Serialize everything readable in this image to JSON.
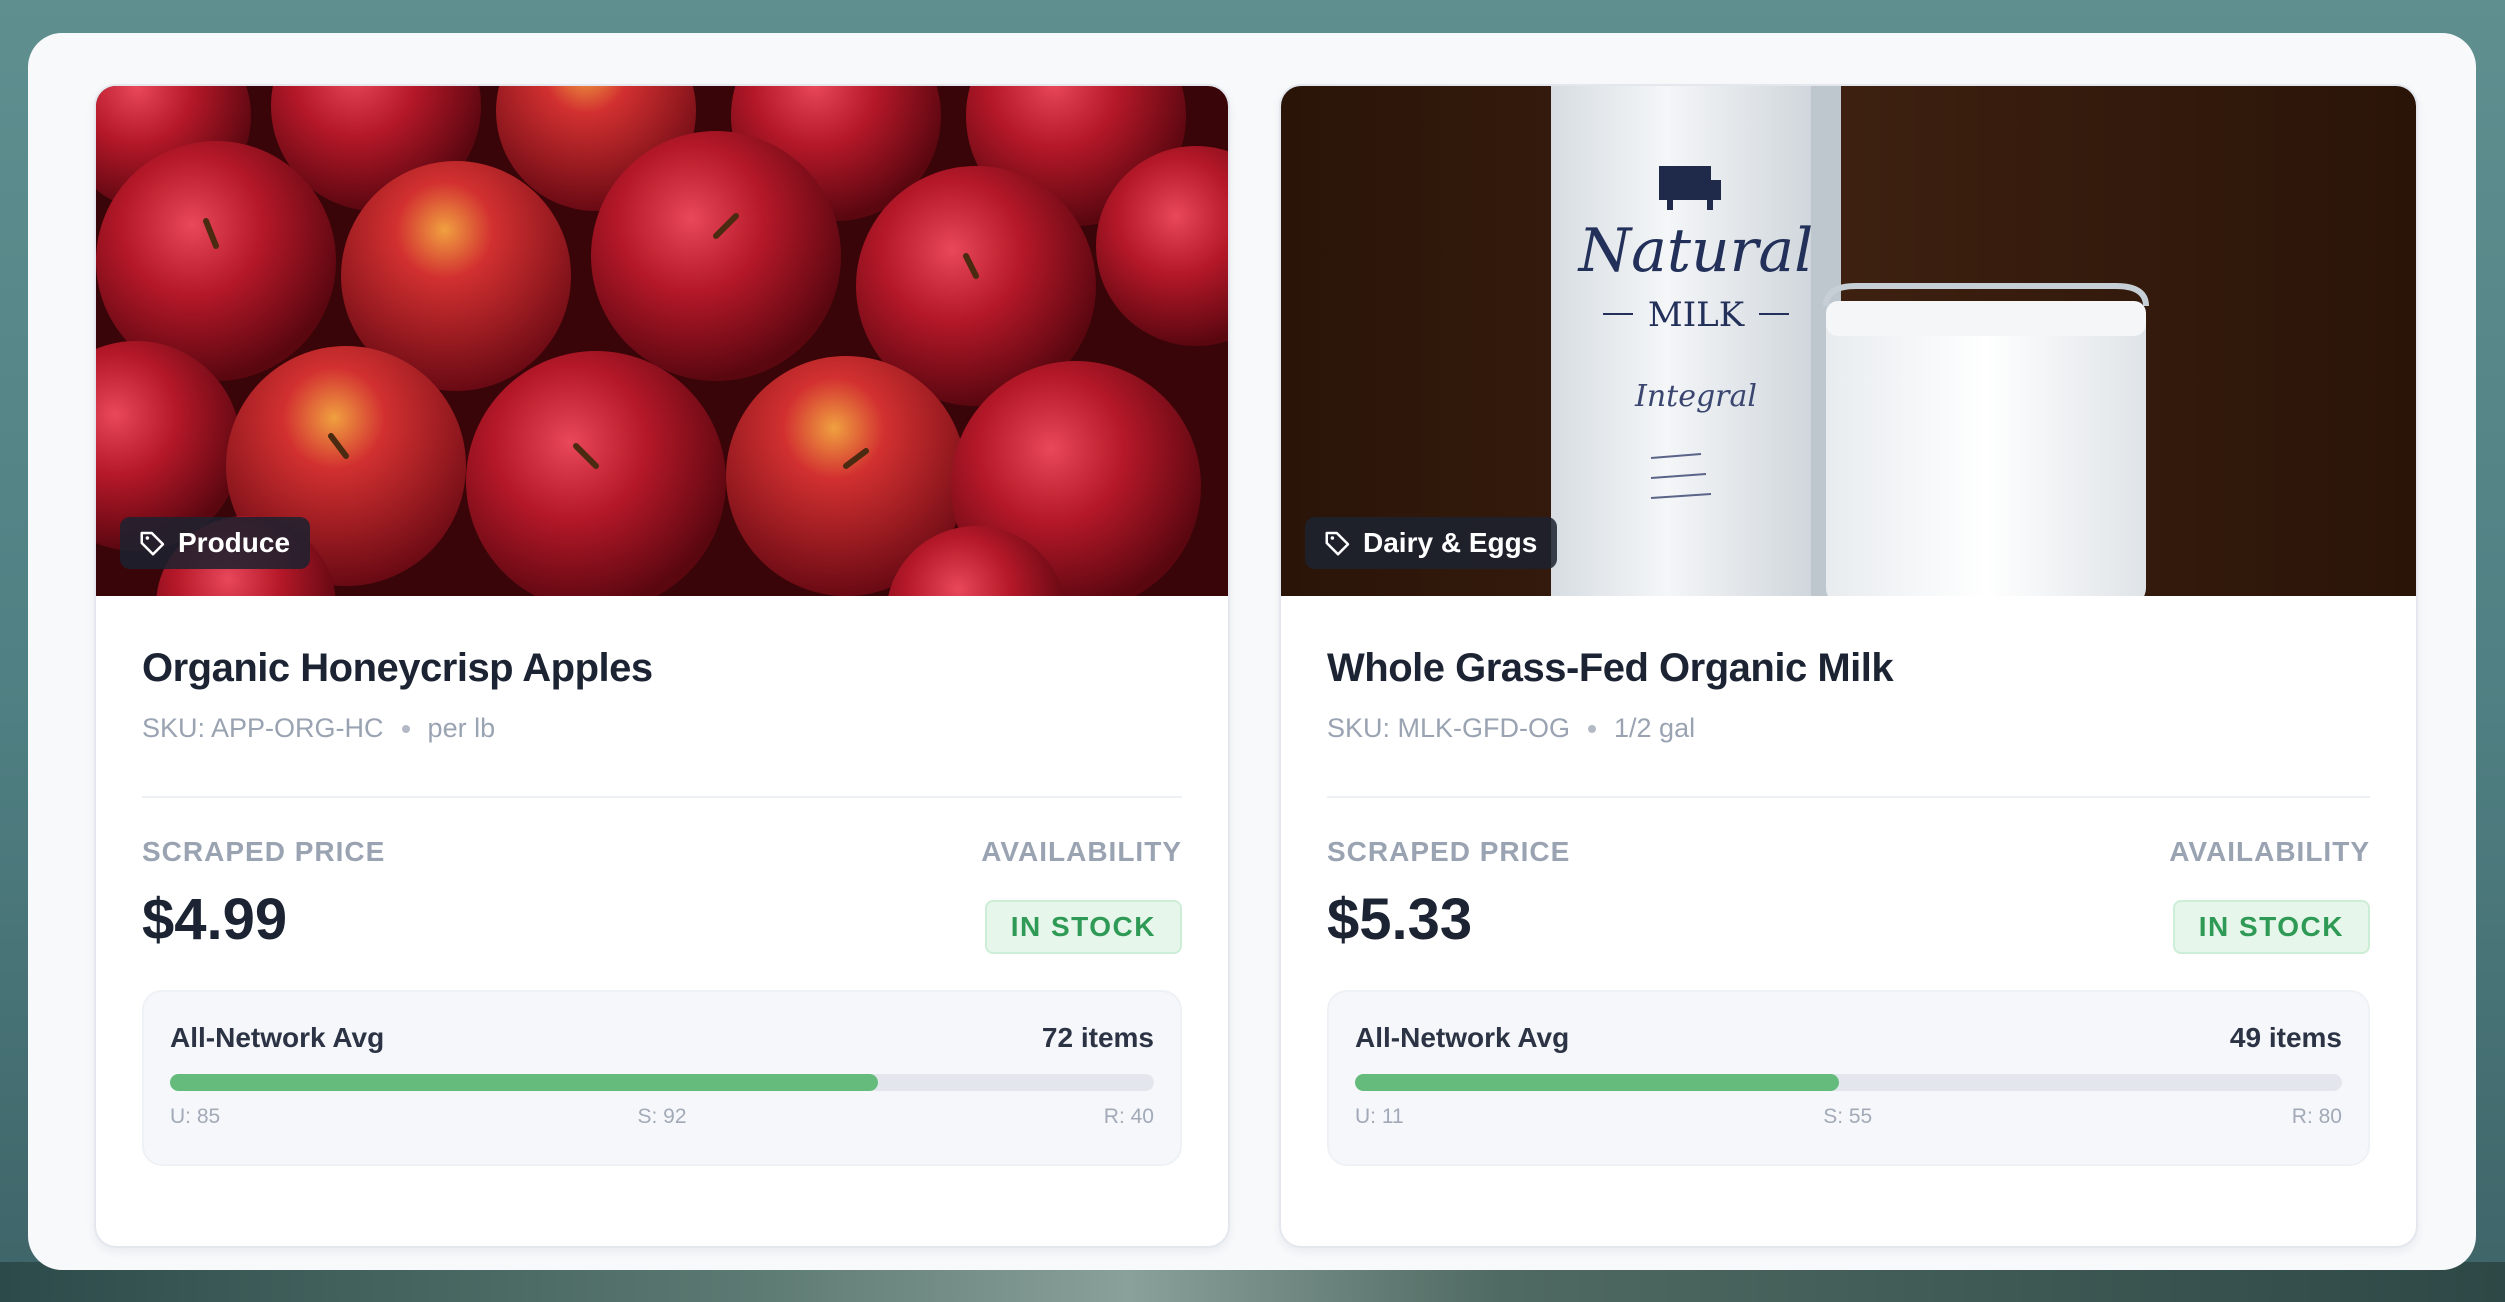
{
  "cards": [
    {
      "category": "Produce",
      "title": "Organic Honeycrisp Apples",
      "sku": "SKU: APP-ORG-HC",
      "unit": "per lb",
      "price_label": "SCRAPED PRICE",
      "price": "$4.99",
      "availability_label": "AVAILABILITY",
      "availability": "IN STOCK",
      "network_label": "All-Network Avg",
      "items": "72 items",
      "progress": 0.72,
      "u": "U: 85",
      "s": "S: 92",
      "r": "R: 40"
    },
    {
      "category": "Dairy & Eggs",
      "title": "Whole Grass-Fed Organic Milk",
      "sku": "SKU: MLK-GFD-OG",
      "unit": "1/2 gal",
      "price_label": "SCRAPED PRICE",
      "price": "$5.33",
      "availability_label": "AVAILABILITY",
      "availability": "IN STOCK",
      "network_label": "All-Network Avg",
      "items": "49 items",
      "progress": 0.49,
      "u": "U: 11",
      "s": "S: 55",
      "r": "R: 80",
      "carton_text": "Natural",
      "carton_sub": "MILK",
      "carton_script": "Integral"
    }
  ],
  "colors": {
    "accent_green": "#64bb7c",
    "stock_green": "#2f9a55",
    "text_dark": "#1c2434",
    "text_muted": "#9aa3b2"
  },
  "icons": {
    "category": "tag-icon"
  }
}
